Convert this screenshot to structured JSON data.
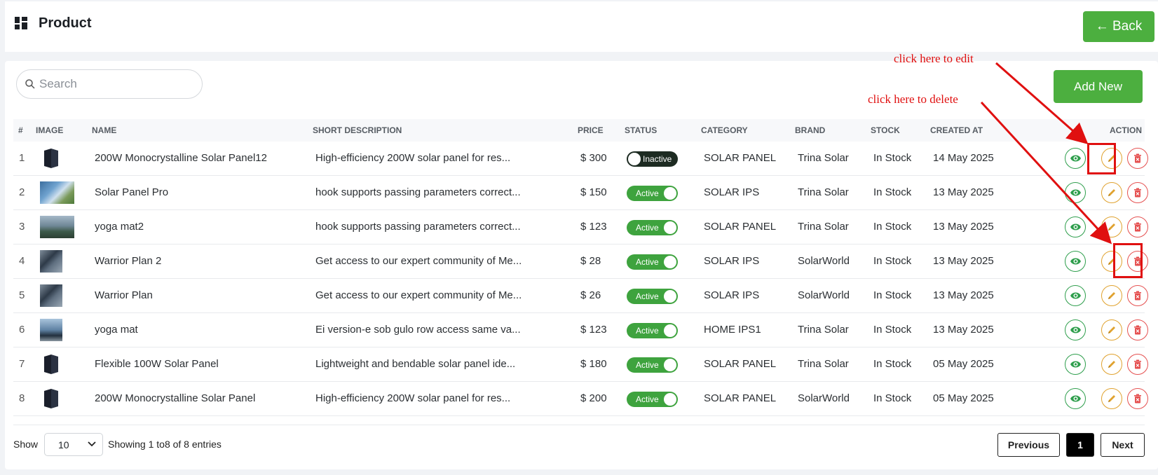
{
  "header": {
    "title": "Product",
    "back_label": "← Back"
  },
  "toolbar": {
    "search_placeholder": "Search",
    "search_value": "",
    "add_label": "Add New"
  },
  "table": {
    "columns": [
      "#",
      "IMAGE",
      "NAME",
      "SHORT DESCRIPTION",
      "PRICE",
      "STATUS",
      "CATEGORY",
      "BRAND",
      "STOCK",
      "CREATED AT",
      "ACTION"
    ],
    "rows": [
      {
        "num": "1",
        "image": "solar-panel-icon",
        "name": "200W Monocrystalline Solar Panel12",
        "desc": "High-efficiency 200W solar panel for res...",
        "price": "$ 300",
        "status": "Inactive",
        "category": "SOLAR PANEL",
        "brand": "Trina Solar",
        "stock": "In Stock",
        "created": "14 May 2025"
      },
      {
        "num": "2",
        "image": "photo-solar-field",
        "name": "Solar Panel Pro",
        "desc": "hook supports passing parameters correct...",
        "price": "$ 150",
        "status": "Active",
        "category": "SOLAR IPS",
        "brand": "Trina Solar",
        "stock": "In Stock",
        "created": "13 May 2025"
      },
      {
        "num": "3",
        "image": "photo-solar-landscape",
        "name": "yoga mat2",
        "desc": "hook supports passing parameters correct...",
        "price": "$ 123",
        "status": "Active",
        "category": "SOLAR PANEL",
        "brand": "Trina Solar",
        "stock": "In Stock",
        "created": "13 May 2025"
      },
      {
        "num": "4",
        "image": "photo-panels",
        "name": "Warrior Plan 2",
        "desc": "Get access to our expert community of Me...",
        "price": "$ 28",
        "status": "Active",
        "category": "SOLAR IPS",
        "brand": "SolarWorld",
        "stock": "In Stock",
        "created": "13 May 2025"
      },
      {
        "num": "5",
        "image": "photo-panels",
        "name": "Warrior Plan",
        "desc": "Get access to our expert community of Me...",
        "price": "$ 26",
        "status": "Active",
        "category": "SOLAR IPS",
        "brand": "SolarWorld",
        "stock": "In Stock",
        "created": "13 May 2025"
      },
      {
        "num": "6",
        "image": "photo-solar-roof",
        "name": "yoga mat",
        "desc": "Ei version-e sob gulo row access same va...",
        "price": "$ 123",
        "status": "Active",
        "category": "HOME IPS1",
        "brand": "Trina Solar",
        "stock": "In Stock",
        "created": "13 May 2025"
      },
      {
        "num": "7",
        "image": "solar-panel-icon",
        "name": "Flexible 100W Solar Panel",
        "desc": "Lightweight and bendable solar panel ide...",
        "price": "$ 180",
        "status": "Active",
        "category": "SOLAR PANEL",
        "brand": "Trina Solar",
        "stock": "In Stock",
        "created": "05 May 2025"
      },
      {
        "num": "8",
        "image": "solar-panel-icon",
        "name": "200W Monocrystalline Solar Panel",
        "desc": "High-efficiency 200W solar panel for res...",
        "price": "$ 200",
        "status": "Active",
        "category": "SOLAR PANEL",
        "brand": "SolarWorld",
        "stock": "In Stock",
        "created": "05 May 2025"
      }
    ],
    "action_icons": [
      "eye-icon",
      "pencil-icon",
      "trash-icon"
    ]
  },
  "annotations": {
    "edit": "click here to edit",
    "delete": "click here to delete"
  },
  "footer": {
    "show_label": "Show",
    "page_size": "10",
    "showing_text": "Showing 1  to8  of 8 entries",
    "prev_label": "Previous",
    "current_page": "1",
    "next_label": "Next"
  },
  "colors": {
    "primary": "#4caf3f",
    "active": "#3ea33e",
    "inactive": "#1d2b22",
    "view": "#2e9e4c",
    "edit": "#e0a22f",
    "delete": "#e55050",
    "annotation": "#e01010"
  }
}
